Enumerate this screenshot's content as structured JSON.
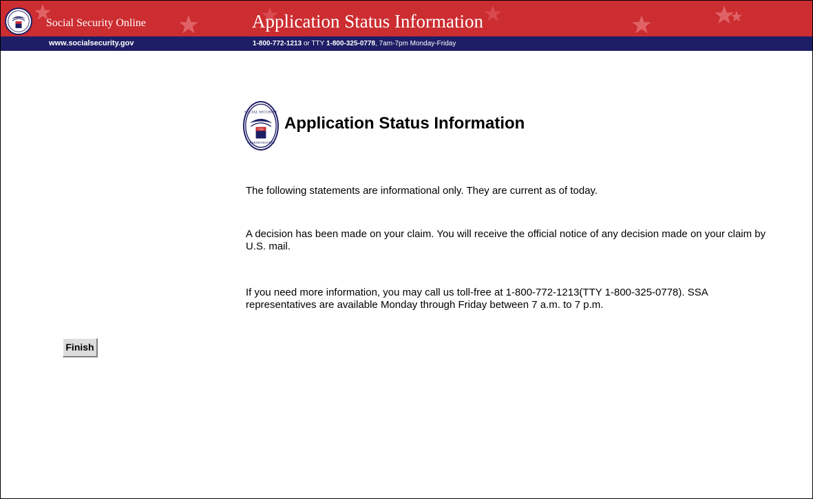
{
  "banner": {
    "site_name": "Social Security Online",
    "site_url": "www.socialsecurity.gov",
    "title": "Application Status Information",
    "phone_number": "1-800-772-1213",
    "phone_or_tty": "or TTY",
    "tty_number": "1-800-325-0778",
    "hours": ", 7am-7pm Monday-Friday",
    "colors": {
      "red": "#cc2d31",
      "navy": "#1e1e66"
    }
  },
  "seal": {
    "text_top": "SOCIAL SECURITY",
    "text_bottom": "ADMINISTRATION",
    "shield_text": "USA"
  },
  "main": {
    "page_title": "Application Status Information",
    "paragraphs": [
      "The following statements are informational only. They are current as of today.",
      "A decision has been made on your claim. You will receive the official notice of any decision made on your claim by U.S. mail.",
      "If you need more information, you may call us toll-free at 1-800-772-1213(TTY 1-800-325-0778). SSA representatives are available Monday through Friday between 7 a.m. to 7 p.m."
    ],
    "finish_label": "Finish"
  }
}
